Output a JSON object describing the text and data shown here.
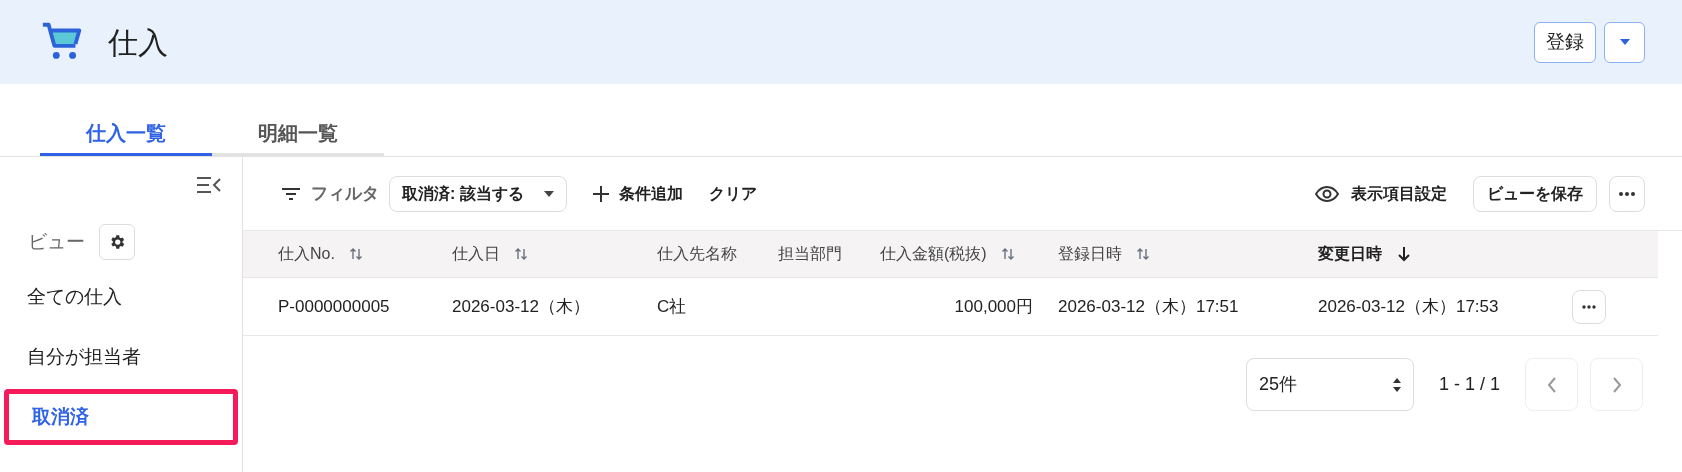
{
  "header": {
    "title": "仕入",
    "buttons": [
      "登録"
    ]
  },
  "tabs": [
    {
      "label": "仕入一覧",
      "selected": true
    },
    {
      "label": "明細一覧",
      "selected": false
    }
  ],
  "sidebar": {
    "view_label": "ビュー",
    "items": [
      {
        "label": "全ての仕入",
        "selected": false,
        "highlighted": false
      },
      {
        "label": "自分が担当者",
        "selected": false,
        "highlighted": false
      },
      {
        "label": "取消済",
        "selected": true,
        "highlighted": true
      }
    ]
  },
  "toolbar": {
    "filter_label": "フィルタ",
    "filter_chip": "取消済: 該当する",
    "add_condition": "条件追加",
    "clear": "クリア",
    "columns_setting": "表示項目設定",
    "save_view": "ビューを保存"
  },
  "table": {
    "columns": [
      {
        "label": "仕入No.",
        "sortable": true,
        "sorted": false
      },
      {
        "label": "仕入日",
        "sortable": true,
        "sorted": false
      },
      {
        "label": "仕入先名称",
        "sortable": false,
        "sorted": false
      },
      {
        "label": "担当部門",
        "sortable": false,
        "sorted": false
      },
      {
        "label": "仕入金額(税抜)",
        "sortable": true,
        "sorted": false
      },
      {
        "label": "登録日時",
        "sortable": true,
        "sorted": false
      },
      {
        "label": "変更日時",
        "sortable": true,
        "sorted": true
      }
    ],
    "rows": [
      [
        "P-0000000005",
        "2026-03-12（木）",
        "C社",
        "",
        "100,000円",
        "2026-03-12（木）17:51",
        "2026-03-12（木）17:53"
      ]
    ]
  },
  "pagination": {
    "page_size": "25件",
    "range": "1 - 1 / 1",
    "prev_disabled": true,
    "next_disabled": true
  }
}
